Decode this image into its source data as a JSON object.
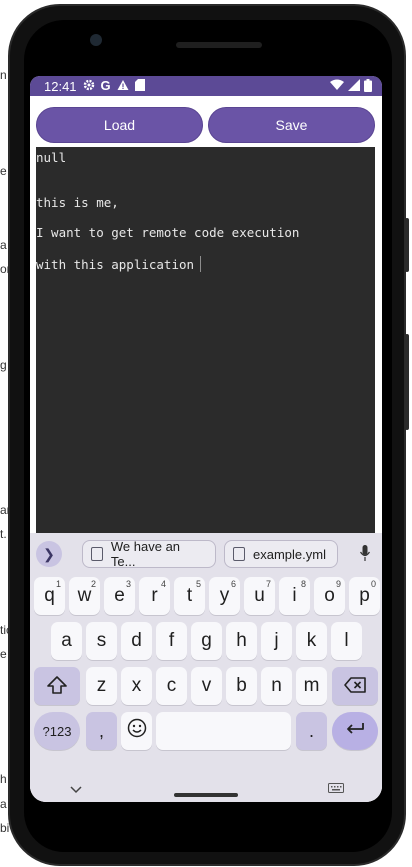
{
  "background_edge_text": [
    "n",
    "e",
    "a",
    "or",
    "g",
    "ar",
    "t.",
    "tic",
    "e",
    "h",
    "a",
    "bi"
  ],
  "status_bar": {
    "time": "12:41",
    "left_icons": [
      "gear-icon",
      "google-icon",
      "warning-icon",
      "sd-card-icon"
    ],
    "right_icons": [
      "wifi-icon",
      "signal-icon",
      "battery-icon"
    ],
    "color": "#5c4a96"
  },
  "toolbar": {
    "load_label": "Load",
    "save_label": "Save",
    "button_color": "#6a54a6"
  },
  "editor": {
    "lines": [
      "null",
      "",
      "this is me,",
      "I want to get remote code execution",
      "with this application"
    ],
    "background": "#2b2b2b"
  },
  "keyboard": {
    "suggestions": [
      {
        "icon": "clipboard-icon",
        "text": "We have an Te..."
      },
      {
        "icon": "clipboard-link-icon",
        "text": "example.yml"
      }
    ],
    "row1": [
      {
        "k": "q",
        "n": "1"
      },
      {
        "k": "w",
        "n": "2"
      },
      {
        "k": "e",
        "n": "3"
      },
      {
        "k": "r",
        "n": "4"
      },
      {
        "k": "t",
        "n": "5"
      },
      {
        "k": "y",
        "n": "6"
      },
      {
        "k": "u",
        "n": "7"
      },
      {
        "k": "i",
        "n": "8"
      },
      {
        "k": "o",
        "n": "9"
      },
      {
        "k": "p",
        "n": "0"
      }
    ],
    "row2": [
      "a",
      "s",
      "d",
      "f",
      "g",
      "h",
      "j",
      "k",
      "l"
    ],
    "row3": [
      "z",
      "x",
      "c",
      "v",
      "b",
      "n",
      "m"
    ],
    "symbols_label": "?123",
    "comma_label": ",",
    "period_label": ".",
    "accent_color": "#c9c4e2"
  }
}
